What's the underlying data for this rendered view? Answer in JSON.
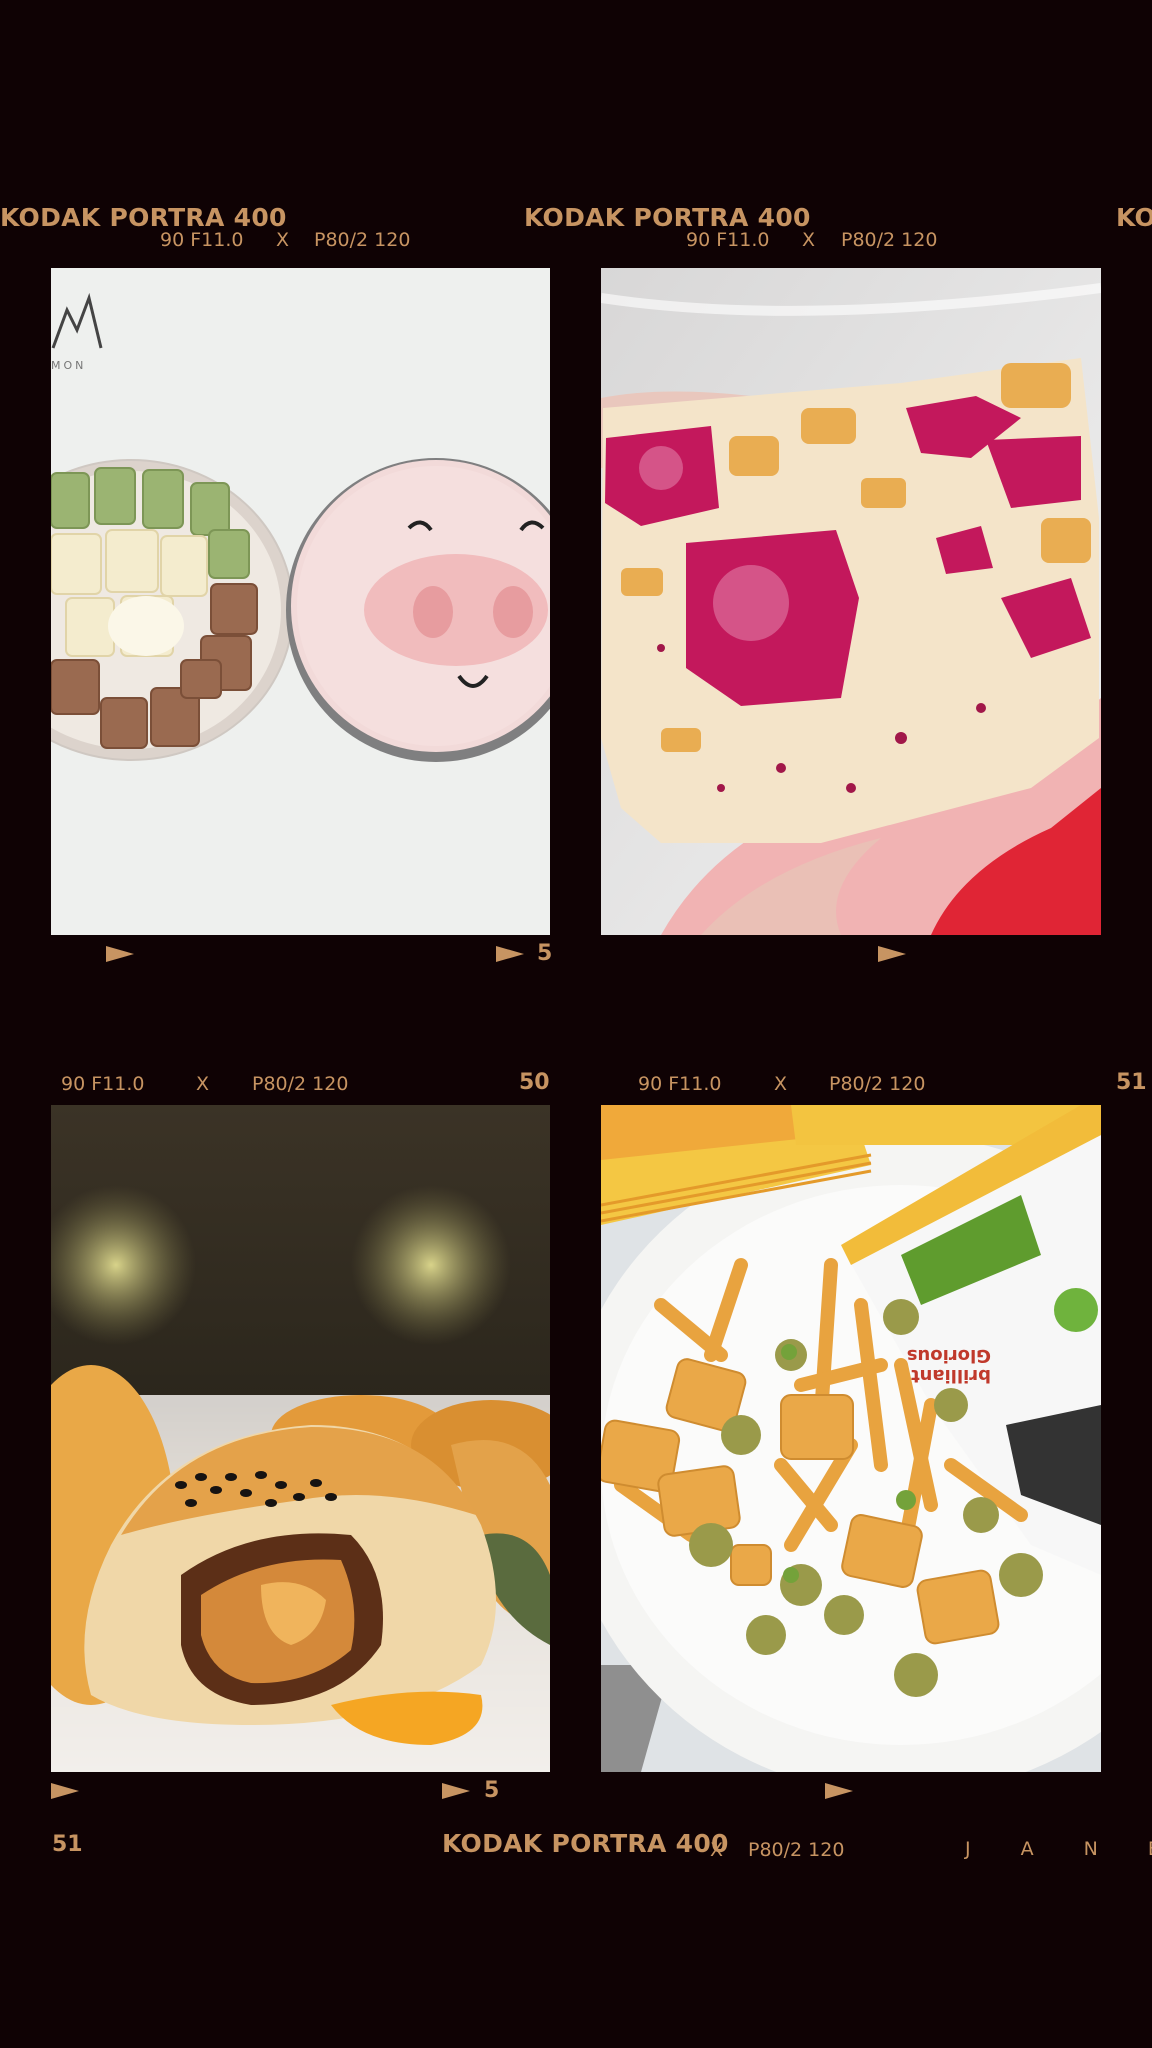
{
  "film_strip_top": {
    "brand_1": "KODAK PORTRA 400",
    "brand_2": "KODAK PORTRA 400",
    "brand_3_partial": "KO",
    "code_1": {
      "a": "90 F11.0",
      "x": "X",
      "b": "P80/2 120"
    },
    "code_2": {
      "a": "90 F11.0",
      "x": "X",
      "b": "P80/2 120"
    },
    "frame_number": "5"
  },
  "film_strip_middle": {
    "code_1": {
      "a": "90 F11.0",
      "x": "X",
      "b": "P80/2 120"
    },
    "code_2": {
      "a": "90 F11.0",
      "x": "X",
      "b": "P80/2 120"
    },
    "number_1": "50",
    "number_2": "51"
  },
  "film_strip_bottom": {
    "frame_number": "5",
    "number": "51",
    "brand": "KODAK PORTRA 400",
    "code_x": "X",
    "code_b": "P80/2 120",
    "signature": "J A N E"
  },
  "photos": {
    "cookie_tin": {
      "logo_text": "MON"
    },
    "snack_bag": {
      "bag_text_1": "Glorious",
      "bag_text_2": "brilliant"
    }
  },
  "colors": {
    "background": "#0f0204",
    "film_text": "#c79462"
  }
}
